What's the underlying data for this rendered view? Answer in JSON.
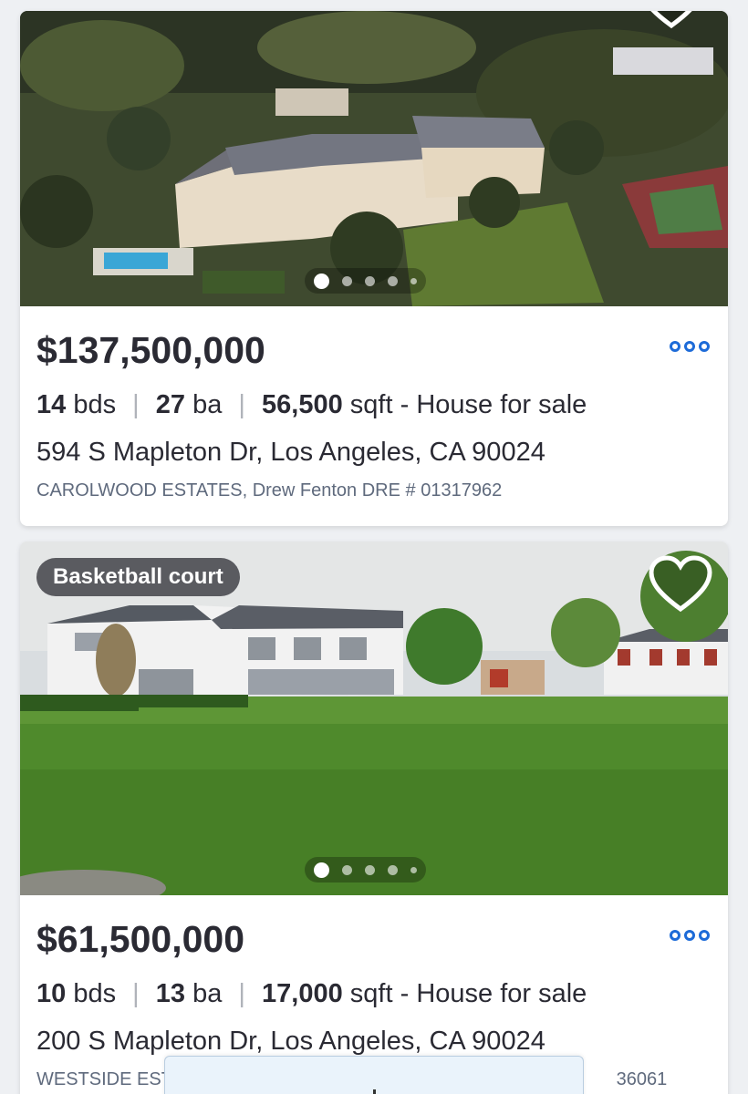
{
  "listings": [
    {
      "price": "$137,500,000",
      "beds_num": "14",
      "beds_unit": "bds",
      "baths_num": "27",
      "baths_unit": "ba",
      "sqft_num": "56,500",
      "sqft_unit": "sqft",
      "type": "- House for sale",
      "address": "594 S Mapleton Dr, Los Angeles, CA 90024",
      "broker": "CAROLWOOD ESTATES, Drew Fenton DRE # 01317962",
      "photo_count_dots": 5,
      "active_photo": 1
    },
    {
      "badge": "Basketball court",
      "price": "$61,500,000",
      "beds_num": "10",
      "beds_unit": "bds",
      "baths_num": "13",
      "baths_unit": "ba",
      "sqft_num": "17,000",
      "sqft_unit": "sqft",
      "type": "- House for sale",
      "address": "200 S Mapleton Dr, Los Angeles, CA 90024",
      "broker_start": "WESTSIDE EST",
      "broker_end": "36061",
      "photo_count_dots": 5,
      "active_photo": 1
    }
  ],
  "separator": "|",
  "icons": {
    "save": "heart-icon",
    "menu": "more-options-icon"
  },
  "colors": {
    "accent": "#1d6bd8",
    "text": "#2a2a33",
    "muted": "#5f6a7d"
  }
}
